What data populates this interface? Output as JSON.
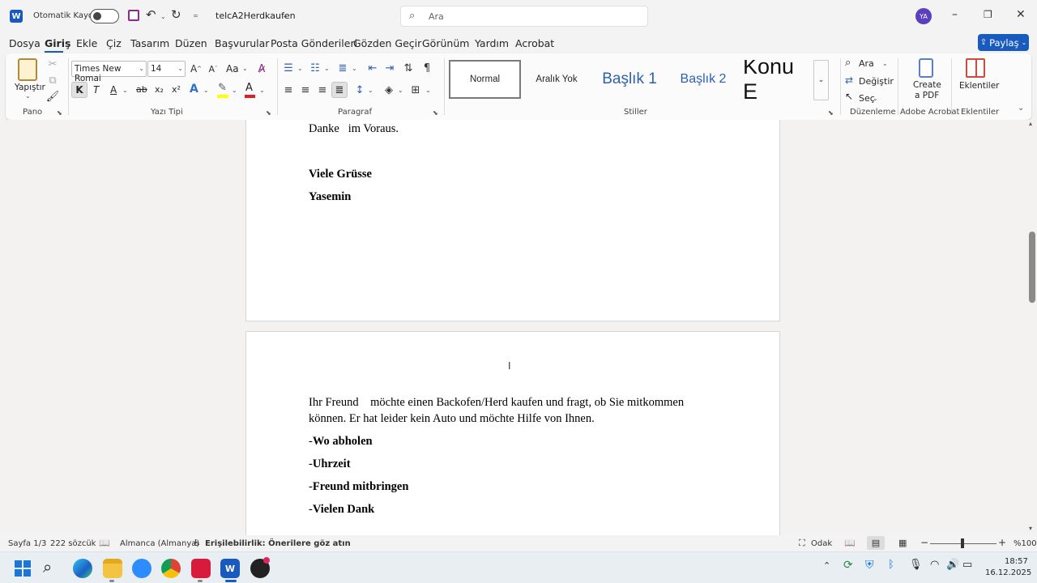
{
  "titlebar": {
    "autosave_label": "Otomatik Kaydet",
    "filename": "telcA2Herdkaufen",
    "search_placeholder": "Ara",
    "avatar_initials": "YA"
  },
  "menu": [
    "Dosya",
    "Giriş",
    "Ekle",
    "Çiz",
    "Tasarım",
    "Düzen",
    "Başvurular",
    "Posta Gönderileri",
    "Gözden Geçir",
    "Görünüm",
    "Yardım",
    "Acrobat"
  ],
  "share_label": "Paylaş",
  "ribbon": {
    "paste_label": "Yapıştır",
    "font_name": "Times New Romai",
    "font_size": "14",
    "change_case": "Aa",
    "bold": "K",
    "italic": "T",
    "underline": "A",
    "strike": "ab",
    "sub": "x₂",
    "sup": "x²",
    "styles": [
      "Normal",
      "Aralık Yok",
      "Başlık 1",
      "Başlık 2",
      "Konu E"
    ],
    "find": "Ara",
    "replace": "Değiştir",
    "select": "Seç",
    "create_pdf_1": "Create",
    "create_pdf_2": "a PDF",
    "addins": "Eklentiler",
    "groups": {
      "pano": "Pano",
      "font": "Yazı Tipi",
      "paragraph": "Paragraf",
      "styles": "Stiller",
      "editing": "Düzenleme",
      "acrobat": "Adobe Acrobat",
      "addins": "Eklentiler"
    }
  },
  "document": {
    "page1": {
      "line1": "Danke   im Voraus.",
      "line2": "Viele Grüsse",
      "line3": "Yasemin"
    },
    "page2": {
      "para1_line1": "Ihr Freund    möchte einen Backofen/Herd kaufen und fragt, ob Sie mitkommen",
      "para1_line2": "können. Er hat leider kein Auto und möchte Hilfe von Ihnen.",
      "bullets": [
        {
          "dash": "-",
          "text": "Wo abholen"
        },
        {
          "dash": "-",
          "text": "Uhrzeit"
        },
        {
          "dash": "-",
          "text": "Freund mitbringen"
        },
        {
          "dash": "-",
          "text": "Vielen Dank"
        }
      ]
    }
  },
  "status": {
    "page": "Sayfa 1/3",
    "words": "222 sözcük",
    "language": "Almanca (Almanya)",
    "accessibility": "Erişilebilirlik: Önerilere göz atın",
    "focus": "Odak",
    "zoom": "%100"
  },
  "taskbar": {
    "time": "18:57",
    "date": "16.12.2025"
  },
  "colors": {
    "accent": "#185abd",
    "title_bg": "#f3f3f3",
    "underline_accent": "#185abd"
  }
}
